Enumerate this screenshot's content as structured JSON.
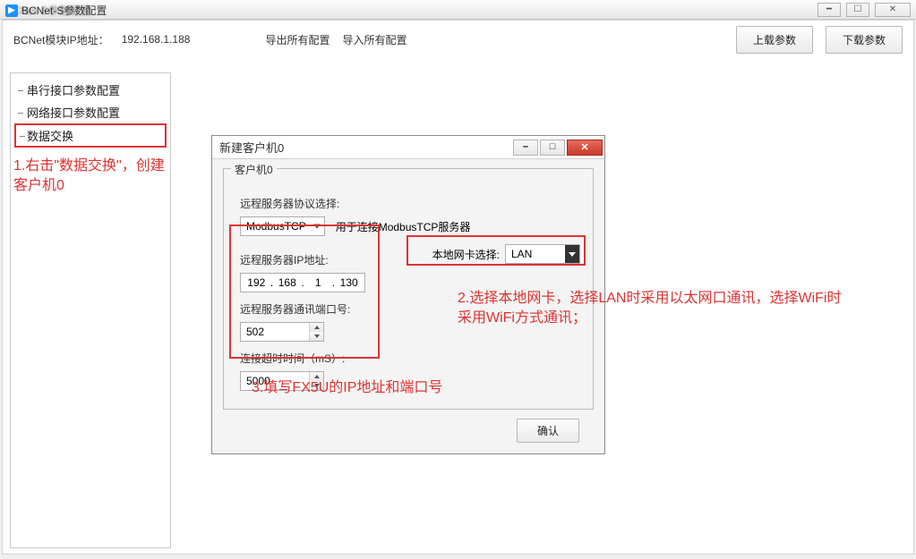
{
  "window": {
    "outer_title_hint": "BCNet-S参数配置",
    "app_title": "BCNet-S参数配置"
  },
  "toolbar": {
    "ip_label": "BCNet模块IP地址：",
    "ip_value": "192.168.1.188",
    "export_label": "导出所有配置",
    "import_label": "导入所有配置",
    "upload_label": "上载参数",
    "download_label": "下载参数"
  },
  "tree": {
    "items": [
      "串行接口参数配置",
      "网络接口参数配置",
      "数据交换"
    ]
  },
  "annot": {
    "a1": "1.右击\"数据交换\"，创建客户机0",
    "a2": "2.选择本地网卡，选择LAN时采用以太网口通讯，选择WiFi时采用WiFi方式通讯；",
    "a3": "3.填写FX5U的IP地址和端口号"
  },
  "dialog": {
    "title": "新建客户机0",
    "group_legend": "客户机0",
    "protocol_label": "远程服务器协议选择:",
    "protocol_value": "ModbusTCP",
    "protocol_hint": "用于连接ModbusTCP服务器",
    "ip_label": "远程服务器IP地址:",
    "ip_oct1": "192",
    "ip_oct2": "168",
    "ip_oct3": "1",
    "ip_oct4": "130",
    "port_label": "远程服务器通讯端口号:",
    "port_value": "502",
    "timeout_label": "连接超时时间（mS）:",
    "timeout_value": "5000",
    "nic_label": "本地网卡选择:",
    "nic_value": "LAN",
    "confirm_label": "确认"
  }
}
